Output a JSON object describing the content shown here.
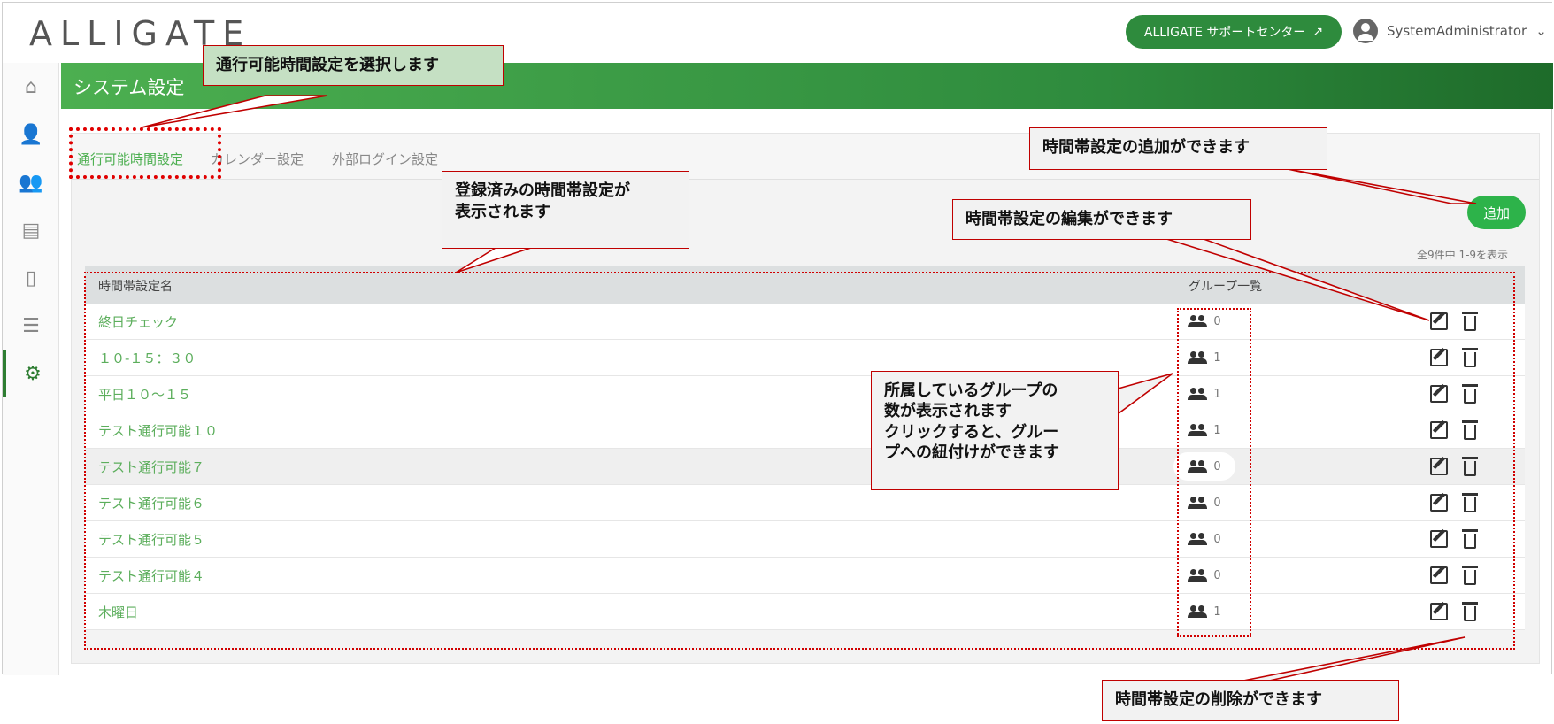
{
  "topbar": {
    "logo": "ALLIGATE",
    "support_label": "ALLIGATE サポートセンター",
    "user_name": "SystemAdministrator"
  },
  "sidebar": {
    "items": [
      {
        "name": "home",
        "icon": "home-icon"
      },
      {
        "name": "user",
        "icon": "person-icon"
      },
      {
        "name": "groups",
        "icon": "people-icon"
      },
      {
        "name": "id-card",
        "icon": "id-card-icon"
      },
      {
        "name": "door",
        "icon": "door-icon"
      },
      {
        "name": "list",
        "icon": "list-icon"
      },
      {
        "name": "settings",
        "icon": "gear-icon",
        "active": true
      }
    ]
  },
  "header": {
    "title": "システム設定"
  },
  "tabs": [
    {
      "label": "通行可能時間設定",
      "active": true
    },
    {
      "label": "カレンダー設定"
    },
    {
      "label": "外部ログイン設定"
    }
  ],
  "actions": {
    "add_label": "追加",
    "count_text": "全9件中 1-9を表示"
  },
  "table": {
    "headers": {
      "name": "時間帯設定名",
      "groups": "グループ一覧"
    },
    "rows": [
      {
        "name": "終日チェック",
        "groups": "0"
      },
      {
        "name": "１０-１５：３０",
        "groups": "1"
      },
      {
        "name": "平日１０～１５",
        "groups": "1"
      },
      {
        "name": "テスト通行可能１０",
        "groups": "1"
      },
      {
        "name": "テスト通行可能７",
        "groups": "0"
      },
      {
        "name": "テスト通行可能６",
        "groups": "0"
      },
      {
        "name": "テスト通行可能５",
        "groups": "0"
      },
      {
        "name": "テスト通行可能４",
        "groups": "0"
      },
      {
        "name": "木曜日",
        "groups": "1"
      }
    ]
  },
  "annotations": {
    "select_tab": "通行可能時間設定を選択します",
    "add": "時間帯設定の追加ができます",
    "registered_1": "登録済みの時間帯設定が",
    "registered_2": "表示されます",
    "edit": "時間帯設定の編集ができます",
    "groups_1": "所属しているグループの",
    "groups_2": "数が表示されます",
    "groups_3": "クリックすると、グルー",
    "groups_4": "プへの紐付けができます",
    "delete": "時間帯設定の削除ができます"
  },
  "colors": {
    "accent": "#2e8b3d",
    "link": "#5cae5c",
    "annotation_border": "#c00000"
  }
}
